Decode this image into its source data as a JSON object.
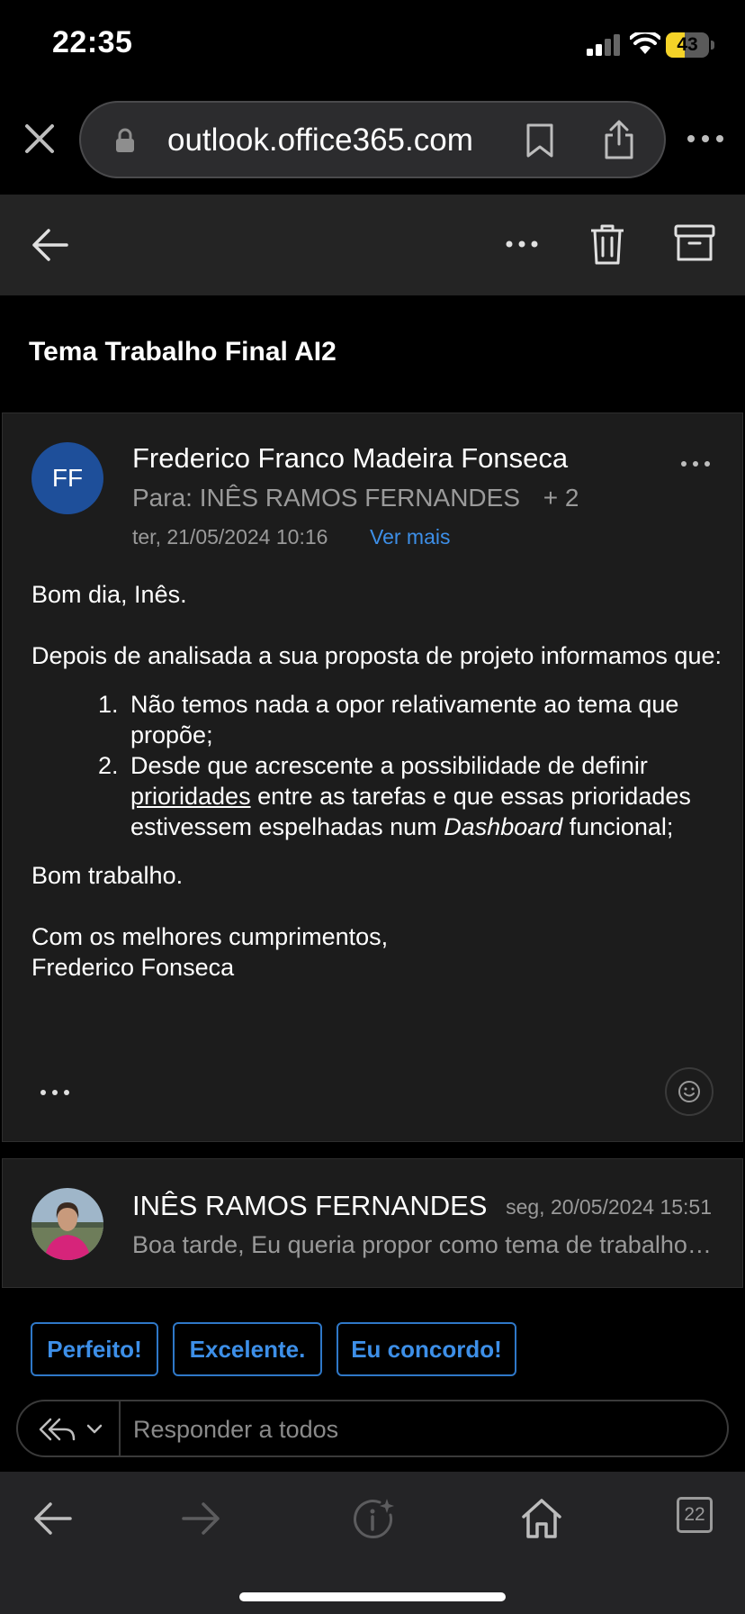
{
  "status_bar": {
    "time": "22:35",
    "battery": "43",
    "battery_level": 0.43
  },
  "browser": {
    "url": "outlook.office365.com"
  },
  "email": {
    "subject": "Tema Trabalho Final AI2",
    "sender_initials": "FF",
    "sender": "Frederico Franco Madeira Fonseca",
    "to_label": "Para:",
    "to": "INÊS RAMOS FERNANDES",
    "to_extra": "+ 2",
    "date": "ter, 21/05/2024 10:16",
    "see_more": "Ver mais",
    "body": {
      "greeting": "Bom dia, Inês.",
      "intro": "Depois de analisada a sua proposta de projeto informamos que:",
      "item1_num": "1.",
      "item1": "Não temos nada a opor relativamente ao tema que propõe;",
      "item2_num": "2.",
      "item2_a": "Desde que acrescente a possibilidade de definir ",
      "item2_link": "prioridades",
      "item2_b": " entre as tarefas e que essas prioridades estivessem espelhadas num ",
      "item2_italic": "Dashboard",
      "item2_c": " funcional;",
      "closing1": "Bom trabalho.",
      "closing2": "Com os melhores cumprimentos,",
      "signature": "Frederico Fonseca"
    }
  },
  "previous_message": {
    "sender": "INÊS RAMOS FERNANDES",
    "date": "seg, 20/05/2024 15:51",
    "snippet": "Boa tarde, Eu queria propor como tema de trabalho final..."
  },
  "quick_replies": [
    "Perfeito!",
    "Excelente.",
    "Eu concordo!"
  ],
  "reply": {
    "placeholder": "Responder a todos"
  },
  "bottom_bar": {
    "tabs_count": "22"
  },
  "colors": {
    "accent": "#3d8fe8",
    "avatar": "#1e4f9a",
    "battery": "#f5d328"
  }
}
